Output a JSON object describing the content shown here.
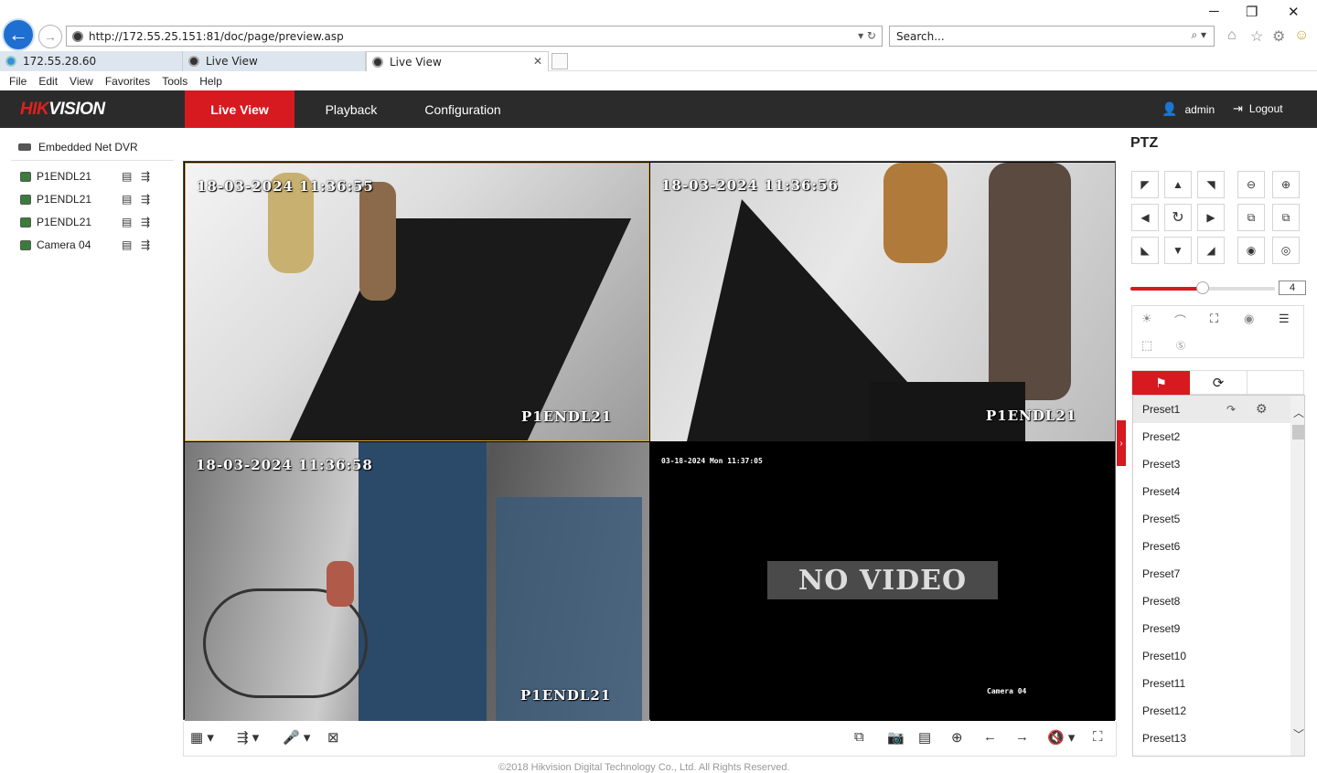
{
  "browser": {
    "address": "http://172.55.25.151:81/doc/page/preview.asp",
    "search_placeholder": "Search...",
    "tabs": [
      {
        "label": "172.55.28.60"
      },
      {
        "label": "Live View"
      },
      {
        "label": "Live View"
      }
    ],
    "menu": [
      "File",
      "Edit",
      "View",
      "Favorites",
      "Tools",
      "Help"
    ]
  },
  "app": {
    "logo_hik": "HIK",
    "logo_vision": "VISION",
    "nav": [
      "Live View",
      "Playback",
      "Configuration"
    ],
    "user": "admin",
    "logout": "Logout"
  },
  "device_tree": {
    "root": "Embedded Net DVR",
    "cameras": [
      {
        "name": "P1ENDL21"
      },
      {
        "name": "P1ENDL21"
      },
      {
        "name": "P1ENDL21"
      },
      {
        "name": "Camera 04"
      }
    ]
  },
  "video": {
    "tiles": [
      {
        "timestamp": "18-03-2024  11:36:55",
        "name": "P1ENDL21"
      },
      {
        "timestamp": "18-03-2024  11:36:56",
        "name": "P1ENDL21"
      },
      {
        "timestamp": "18-03-2024  11:36:58",
        "name": "P1ENDL21"
      },
      {
        "timestamp": "03-18-2024 Mon 11:37:05",
        "name": "Camera 04",
        "no_video": "NO VIDEO"
      }
    ]
  },
  "footer": "©2018 Hikvision Digital Technology Co., Ltd. All Rights Reserved.",
  "ptz": {
    "title": "PTZ",
    "speed": "4",
    "speed_fraction": 0.5,
    "presets": [
      "Preset1",
      "Preset2",
      "Preset3",
      "Preset4",
      "Preset5",
      "Preset6",
      "Preset7",
      "Preset8",
      "Preset9",
      "Preset10",
      "Preset11",
      "Preset12",
      "Preset13"
    ]
  },
  "colors": {
    "accent": "#d71920",
    "header_bg": "#2b2b2b"
  }
}
